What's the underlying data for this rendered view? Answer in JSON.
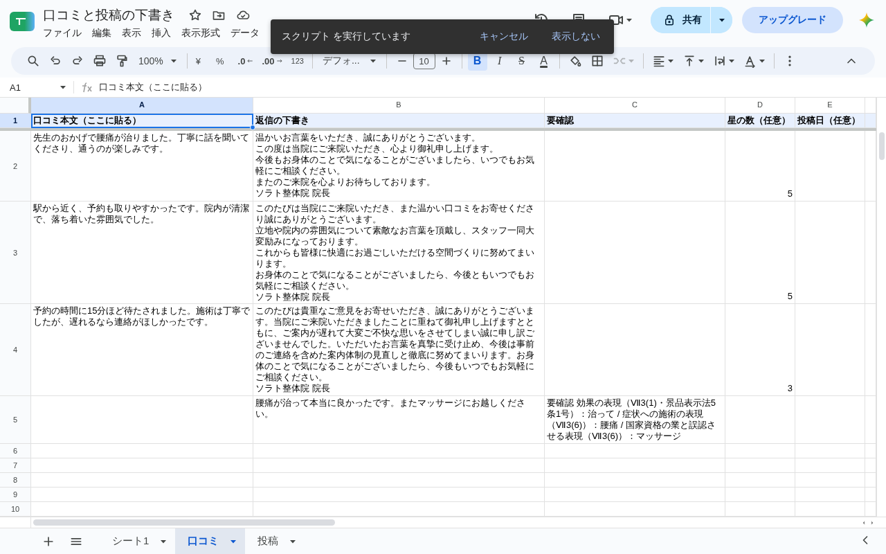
{
  "document": {
    "title": "口コミと投稿の下書き"
  },
  "menu": [
    "ファイル",
    "編集",
    "表示",
    "挿入",
    "表示形式",
    "データ"
  ],
  "share": {
    "label": "共有"
  },
  "upgrade": {
    "label": "アップグレード"
  },
  "toolbar": {
    "zoom": "100%",
    "currency": "¥",
    "percent": "%",
    "decimal_decrease": ".0",
    "decimal_increase": ".00",
    "number_format": "123",
    "font": "デフォ...",
    "font_size": "10",
    "text_styles": [
      {
        "kind": "bold",
        "label": "B",
        "on": true
      },
      {
        "kind": "italic",
        "label": "I",
        "on": false
      },
      {
        "kind": "strikethrough",
        "label": "S",
        "on": false
      },
      {
        "kind": "text_color",
        "label": "A",
        "on": false
      }
    ]
  },
  "formula_bar": {
    "name_box": "A1",
    "formula": "口コミ本文（ここに貼る）"
  },
  "sheet": {
    "columns": [
      {
        "label": "A",
        "selected": true
      },
      {
        "label": "B",
        "selected": false
      },
      {
        "label": "C",
        "selected": false
      },
      {
        "label": "D",
        "selected": false
      },
      {
        "label": "E",
        "selected": false
      }
    ],
    "rows": [
      {
        "number": "1",
        "selected": true,
        "kind": "header",
        "cells": [
          {
            "lines": [
              "口コミ本文（ここに貼る）"
            ],
            "kind": "text",
            "selected": true
          },
          {
            "lines": [
              "返信の下書き"
            ],
            "kind": "text",
            "selected": false
          },
          {
            "lines": [
              "要確認"
            ],
            "kind": "text",
            "selected": false
          },
          {
            "lines": [
              "星の数（任意）"
            ],
            "kind": "text",
            "selected": false
          },
          {
            "lines": [
              "投稿日（任意）"
            ],
            "kind": "text",
            "selected": false
          }
        ]
      },
      {
        "number": "2",
        "selected": false,
        "kind": "data",
        "cells": [
          {
            "lines": [
              "先生のおかげで腰痛が治りました。丁寧に話を聞いてくださり、通うのが楽しみです。"
            ],
            "kind": "text",
            "selected": false
          },
          {
            "lines": [
              "温かいお言葉をいただき、誠にありがとうございます。",
              "この度は当院にご来院いただき、心より御礼申し上げます。",
              "今後もお身体のことで気になることがございましたら、いつでもお気軽にご相談ください。",
              "またのご来院を心よりお待ちしております。",
              "ソラト整体院 院長"
            ],
            "kind": "text",
            "selected": false
          },
          {
            "kind": "empty",
            "selected": false
          },
          {
            "lines": [
              "5"
            ],
            "kind": "number",
            "selected": false
          },
          {
            "kind": "empty",
            "selected": false
          }
        ]
      },
      {
        "number": "3",
        "selected": false,
        "kind": "data",
        "cells": [
          {
            "lines": [
              "駅から近く、予約も取りやすかったです。院内が清潔で、落ち着いた雰囲気でした。"
            ],
            "kind": "text",
            "selected": false
          },
          {
            "lines": [
              "このたびは当院にご来院いただき、また温かい口コミをお寄せくださり誠にありがとうございます。",
              "立地や院内の雰囲気について素敵なお言葉を頂戴し、スタッフ一同大変励みになっております。",
              "これからも皆様に快適にお過ごしいただける空間づくりに努めてまいります。",
              "お身体のことで気になることがございましたら、今後ともいつでもお気軽にご相談ください。",
              "ソラト整体院 院長"
            ],
            "kind": "text",
            "selected": false
          },
          {
            "kind": "empty",
            "selected": false
          },
          {
            "lines": [
              "5"
            ],
            "kind": "number",
            "selected": false
          },
          {
            "kind": "empty",
            "selected": false
          }
        ]
      },
      {
        "number": "4",
        "selected": false,
        "kind": "data",
        "cells": [
          {
            "lines": [
              "予約の時間に15分ほど待たされました。施術は丁寧でしたが、遅れるなら連絡がほしかったです。"
            ],
            "kind": "text",
            "selected": false
          },
          {
            "lines": [
              "このたびは貴重なご意見をお寄せいただき、誠にありがとうございます。当院にご来院いただきましたことに重ねて御礼申し上げますとともに、ご案内が遅れて大変ご不快な思いをさせてしまい誠に申し訳ございませんでした。いただいたお言葉を真摯に受け止め、今後は事前のご連絡を含めた案内体制の見直しと徹底に努めてまいります。お身体のことで気になることがございましたら、今後もいつでもお気軽にご相談ください。",
              "ソラト整体院 院長"
            ],
            "kind": "text",
            "selected": false
          },
          {
            "kind": "empty",
            "selected": false
          },
          {
            "lines": [
              "3"
            ],
            "kind": "number",
            "selected": false
          },
          {
            "kind": "empty",
            "selected": false
          }
        ]
      },
      {
        "number": "5",
        "selected": false,
        "kind": "data",
        "cells": [
          {
            "kind": "empty",
            "selected": false
          },
          {
            "lines": [
              "腰痛が治って本当に良かったです。またマッサージにお越しください。"
            ],
            "kind": "text",
            "selected": false
          },
          {
            "lines": [
              "要確認 効果の表現（Ⅶ3(1)・景品表示法5条1号）：治って / 症状への施術の表現（Ⅶ3(6)）：腰痛 / 国家資格の業と誤認させる表現（Ⅶ3(6)）：マッサージ"
            ],
            "kind": "text",
            "selected": false
          },
          {
            "kind": "empty",
            "selected": false
          },
          {
            "kind": "empty",
            "selected": false
          }
        ]
      },
      {
        "number": "6",
        "selected": false,
        "kind": "data"
      },
      {
        "number": "7",
        "selected": false,
        "kind": "data"
      },
      {
        "number": "8",
        "selected": false,
        "kind": "data"
      },
      {
        "number": "9",
        "selected": false,
        "kind": "data"
      },
      {
        "number": "10",
        "selected": false,
        "kind": "data"
      }
    ]
  },
  "sheet_tabs": [
    {
      "label": "シート1",
      "selected": false
    },
    {
      "label": "口コミ",
      "selected": true
    },
    {
      "label": "投稿",
      "selected": false
    }
  ],
  "toast": {
    "message": "スクリプト を実行しています",
    "actions": [
      "キャンセル",
      "表示しない"
    ]
  }
}
